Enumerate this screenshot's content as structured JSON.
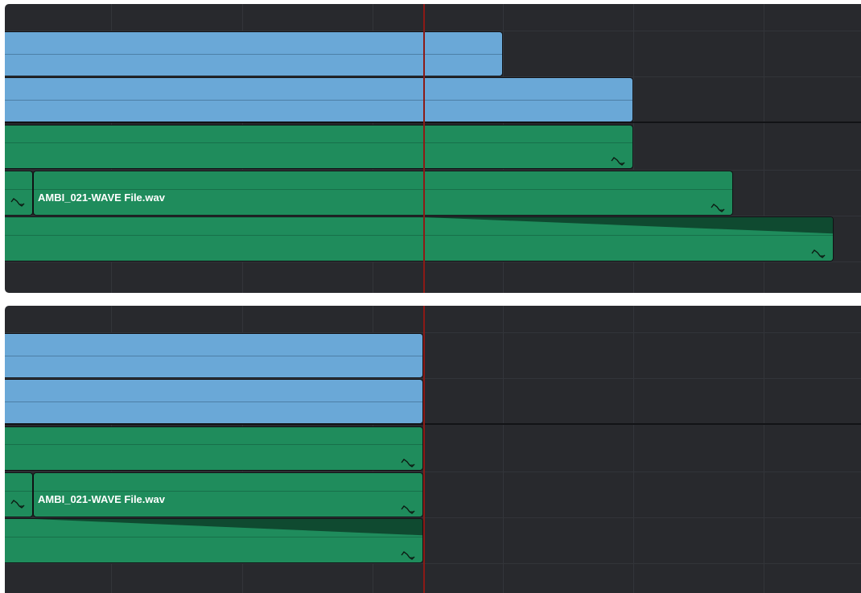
{
  "timeline_top": {
    "clip_name": "AMBI_021-WAVE File.wav"
  },
  "timeline_bottom": {
    "clip_name": "AMBI_021-WAVE File.wav"
  },
  "colors": {
    "video_clip": "#6aa8d7",
    "audio_clip": "#1f8c5c",
    "background": "#28292d",
    "playhead": "#8c1a16"
  },
  "icons": [
    "audio-waveform-icon"
  ]
}
